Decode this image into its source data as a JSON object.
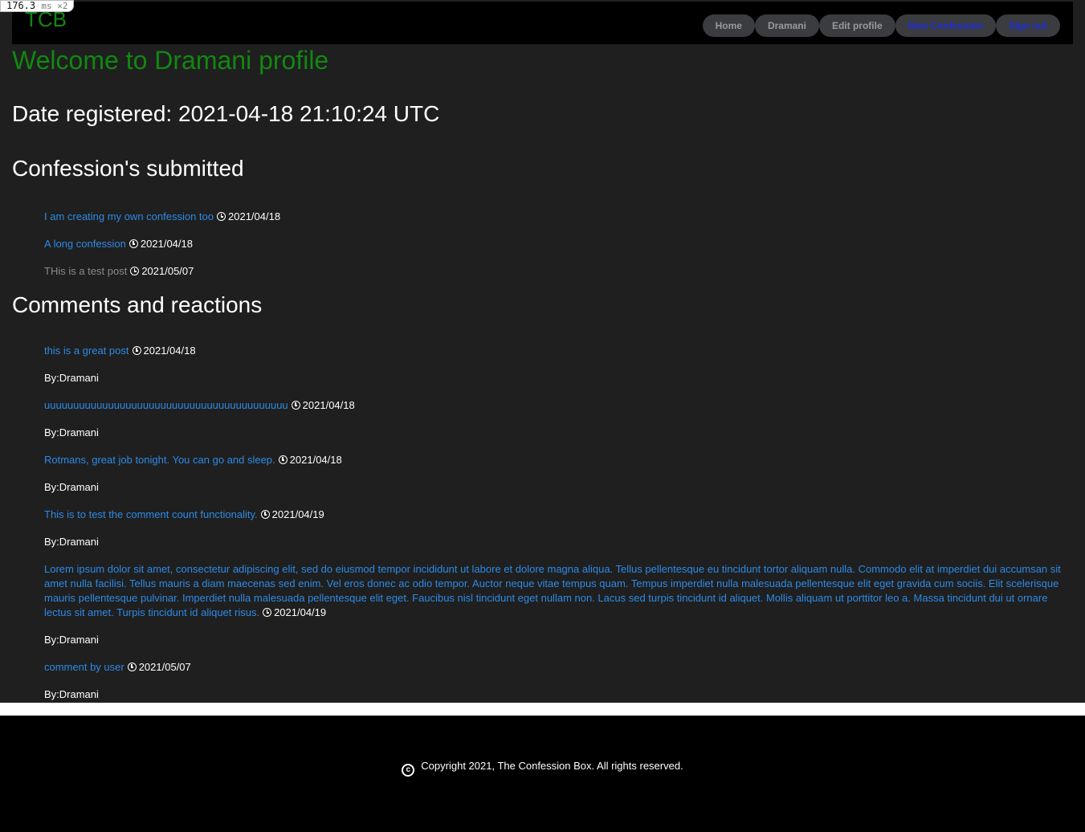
{
  "perf": {
    "value": "176.3",
    "unit": "ms ×2"
  },
  "navbar": {
    "brand": "TCB",
    "links": [
      "Home",
      "Dramani",
      "Edit profile",
      "New Confession",
      "Sign out"
    ]
  },
  "page": {
    "welcome": "Welcome to Dramani profile",
    "date_registered": "Date registered: 2021-04-18 21:10:24 UTC",
    "confessions_heading": "Confession's submitted",
    "comments_heading": "Comments and reactions"
  },
  "confessions": [
    {
      "title": "I am creating my own confession too",
      "date": "2021/04/18"
    },
    {
      "title": "A long confession",
      "date": "2021/04/18"
    },
    {
      "title": "THis is a test post",
      "date": "2021/05/07"
    }
  ],
  "comments": [
    {
      "text": "this is a great post",
      "date": "2021/04/18",
      "by": "By:Dramani"
    },
    {
      "text": "uuuuuuuuuuuuuuuuuuuuuuuuuuuuuuuuuuuuuuuuuu",
      "date": "2021/04/18",
      "by": "By:Dramani"
    },
    {
      "text": "Rotmans, great job tonight. You can go and sleep.",
      "date": "2021/04/18",
      "by": "By:Dramani"
    },
    {
      "text": "This is to test the comment count functionality.",
      "date": "2021/04/19",
      "by": "By:Dramani"
    },
    {
      "text": "Lorem ipsum dolor sit amet, consectetur adipiscing elit, sed do eiusmod tempor incididunt ut labore et dolore magna aliqua. Tellus pellentesque eu tincidunt tortor aliquam nulla. Commodo elit at imperdiet dui accumsan sit amet nulla facilisi. Tellus mauris a diam maecenas sed enim. Vel eros donec ac odio tempor. Auctor neque vitae tempus quam. Tempus imperdiet nulla malesuada pellentesque elit eget gravida cum sociis. Elit scelerisque mauris pellentesque pulvinar. Imperdiet nulla malesuada pellentesque elit eget. Faucibus nisl tincidunt eget nullam non. Lacus sed turpis tincidunt id aliquet. Mollis aliquam ut porttitor leo a. Massa tincidunt dui ut ornare lectus sit amet. Turpis tincidunt id aliquet risus.",
      "date": "2021/04/19",
      "by": "By:Dramani"
    },
    {
      "text": "comment by user",
      "date": "2021/05/07",
      "by": "By:Dramani"
    }
  ],
  "footer": {
    "copyright": "Copyright 2021, The Confession Box. All rights reserved."
  }
}
